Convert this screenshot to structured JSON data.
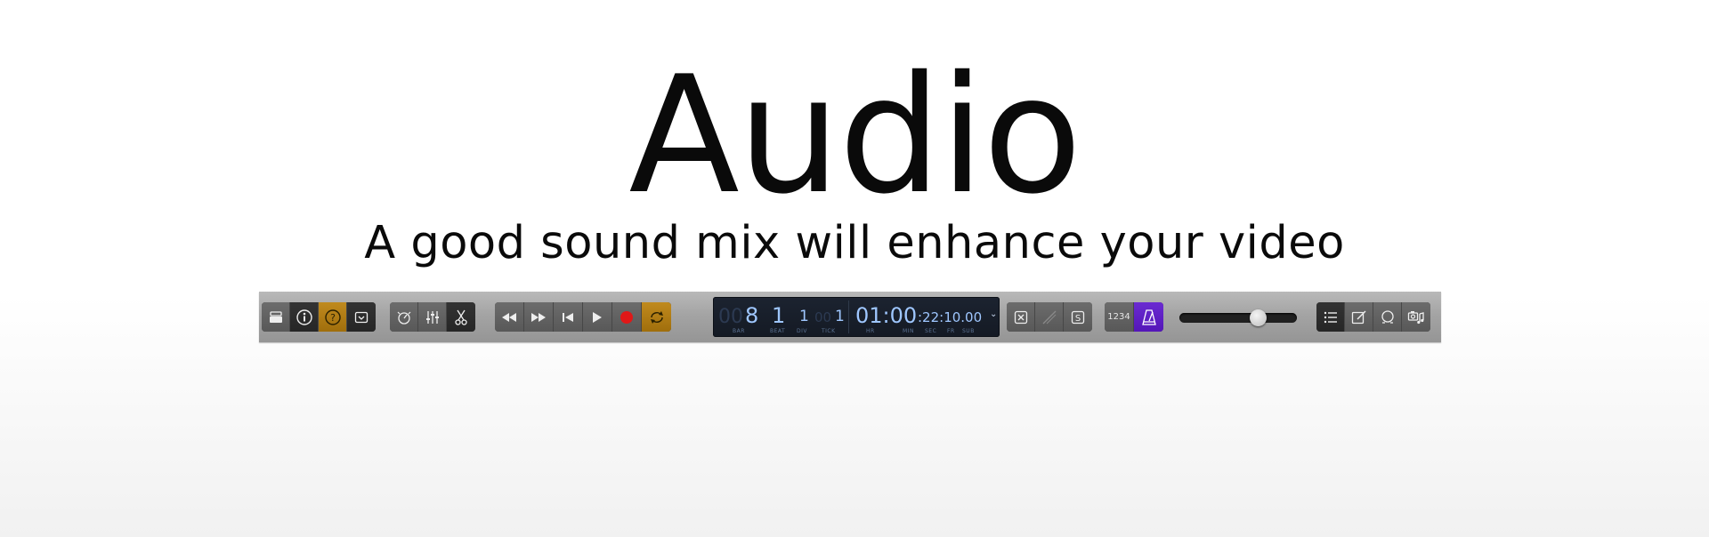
{
  "hero": {
    "title": "Audio",
    "subtitle": "A good sound mix will enhance your video"
  },
  "toolbar": {
    "left_group": [
      "library-icon",
      "info-icon",
      "quick-help-icon",
      "toolbar-icon"
    ],
    "edit_group": [
      "smart-controls-icon",
      "mixer-icon",
      "editors-scissors-icon"
    ],
    "transport_group": [
      "rewind-icon",
      "fast-forward-icon",
      "go-to-beginning-icon",
      "play-icon",
      "record-icon",
      "cycle-icon"
    ],
    "lcd": {
      "bar_prefix": "00",
      "bar": "8",
      "beat": "1",
      "div": "1",
      "tick_prefix": "00",
      "tick": "1",
      "hr_min": "01:00",
      "sec_fr_sub": ":22:10.00",
      "labels": {
        "bar": "BAR",
        "beat": "BEAT",
        "div": "DIV",
        "tick": "TICK",
        "hr": "HR",
        "min": "MIN",
        "sec": "SEC",
        "fr": "FR",
        "sub": "SUB"
      }
    },
    "mode_group": [
      "replace-icon",
      "tuning-icon",
      "solo-icon"
    ],
    "count_in_label": "1234",
    "metronome": "metronome-icon",
    "master_volume": 0.7,
    "right_group": [
      "list-editors-icon",
      "note-pad-icon",
      "loop-browser-icon",
      "media-browser-icon"
    ],
    "colors": {
      "gold_active": "#b07c14",
      "purple_active": "#5f1fc6",
      "record_red": "#e01818",
      "lcd_text": "#9fc7ff"
    }
  }
}
